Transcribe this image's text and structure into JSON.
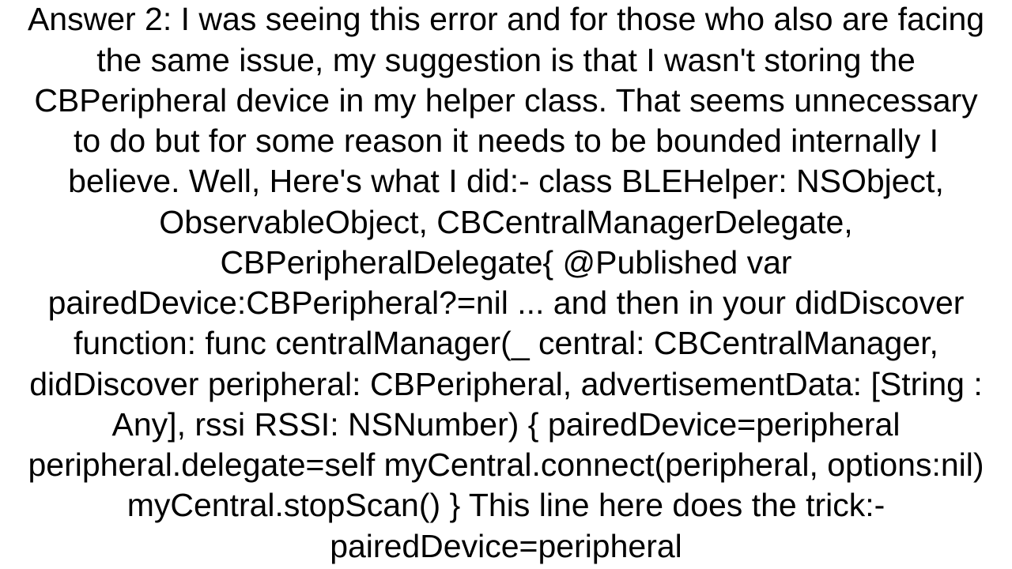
{
  "answer": {
    "text": "Answer 2: I was seeing this error and for those who also are facing the same issue, my suggestion is that I wasn't storing the CBPeripheral device in my helper class. That seems unnecessary to do but for some reason it needs to be bounded internally I believe. Well, Here's what I did:- class BLEHelper: NSObject, ObservableObject, CBCentralManagerDelegate, CBPeripheralDelegate{ @Published var pairedDevice:CBPeripheral?=nil     ...  and then in your didDiscover function: func centralManager(_ central: CBCentralManager, didDiscover peripheral: CBPeripheral, advertisementData: [String : Any], rssi RSSI: NSNumber) { pairedDevice=peripheral peripheral.delegate=self myCentral.connect(peripheral, options:nil) myCentral.stopScan()  } This line here does the trick:- pairedDevice=peripheral"
  }
}
